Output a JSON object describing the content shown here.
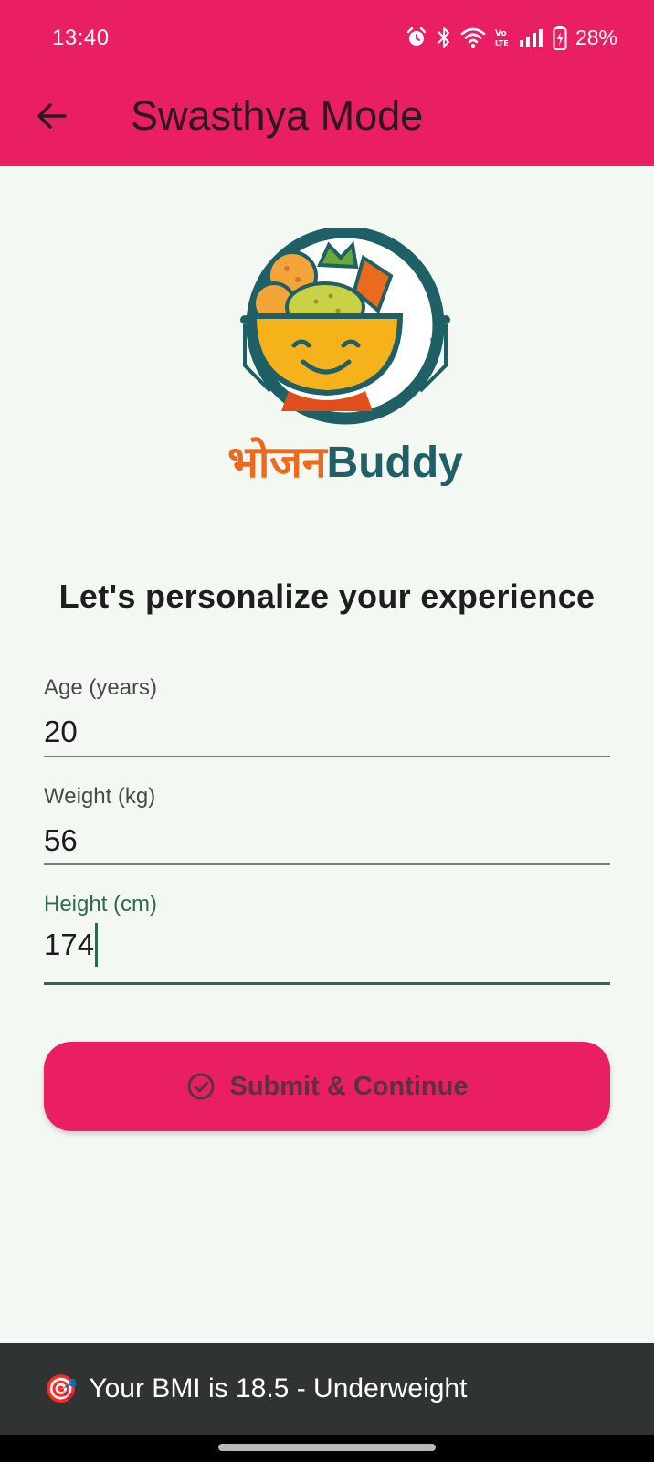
{
  "status_bar": {
    "time": "13:40",
    "battery": "28%",
    "icons": [
      "alarm-icon",
      "bluetooth-icon",
      "wifi-icon",
      "volte-icon",
      "signal-icon",
      "battery-icon"
    ]
  },
  "app_bar": {
    "title": "Swasthya Mode",
    "back_icon": "arrow-back-icon",
    "background": "#e91e63"
  },
  "logo": {
    "word_hindi": "भोजन",
    "word_english": "Buddy"
  },
  "form": {
    "heading": "Let's personalize your experience",
    "fields": [
      {
        "label": "Age (years)",
        "value": "20"
      },
      {
        "label": "Weight (kg)",
        "value": "56"
      },
      {
        "label": "Height (cm)",
        "value": "174",
        "focused": true
      }
    ],
    "submit_label": "Submit & Continue",
    "submit_icon": "check-circle-icon"
  },
  "snackbar": {
    "icon": "🎯",
    "text": "Your BMI is 18.5 - Underweight"
  },
  "colors": {
    "accent": "#e91e63",
    "focus": "#2a6a4d",
    "snackbar": "#2f3331",
    "background": "#f4f8f2"
  }
}
